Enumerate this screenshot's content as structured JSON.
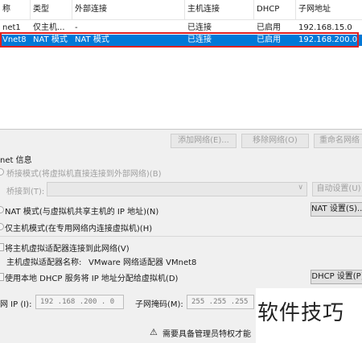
{
  "table": {
    "columns": [
      "称",
      "类型",
      "外部连接",
      "主机连接",
      "DHCP",
      "子网地址"
    ],
    "rows": [
      {
        "name": "net1",
        "type": "仅主机...",
        "external": "-",
        "host": "已连接",
        "dhcp": "已启用",
        "subnet": "192.168.15.0"
      },
      {
        "name": "Vnet8",
        "type": "NAT 模式",
        "external": "NAT 模式",
        "host": "已连接",
        "dhcp": "已启用",
        "subnet": "192.168.200.0"
      }
    ]
  },
  "buttons": {
    "add_network": "添加网络(E)...",
    "remove_network": "移除网络(O)",
    "rename_network": "重命名网络"
  },
  "info": {
    "title": "net 信息",
    "bridge_mode": "桥接模式(将虚拟机直接连接到外部网络)(B)",
    "bridge_to_label": "桥接到(T):",
    "auto_settings": "自动设置(U)",
    "nat_mode": "NAT 模式(与虚拟机共享主机的 IP 地址)(N)",
    "nat_settings": "NAT 设置(S)...",
    "host_only": "仅主机模式(在专用网络内连接虚拟机)(H)",
    "connect_adapter": "将主机虚拟适配器连接到此网络(V)",
    "adapter_name_label": "主机虚拟适配器名称:",
    "adapter_name_value": "VMware 网络适配器 VMnet8",
    "use_dhcp": "使用本地 DHCP 服务将 IP 地址分配给虚拟机(D)",
    "dhcp_settings": "DHCP 设置(P)",
    "subnet_ip_label": "网 IP (I):",
    "subnet_ip_value": "192 .168 .200 .  0",
    "mask_label": "子网掩码(M):",
    "mask_value": "255 .255 .255 .",
    "warning": "需要具备管理员特权才能"
  },
  "watermark": "软件技巧",
  "colors": {
    "selection": "#0078d7",
    "highlight_box": "#e02020"
  }
}
